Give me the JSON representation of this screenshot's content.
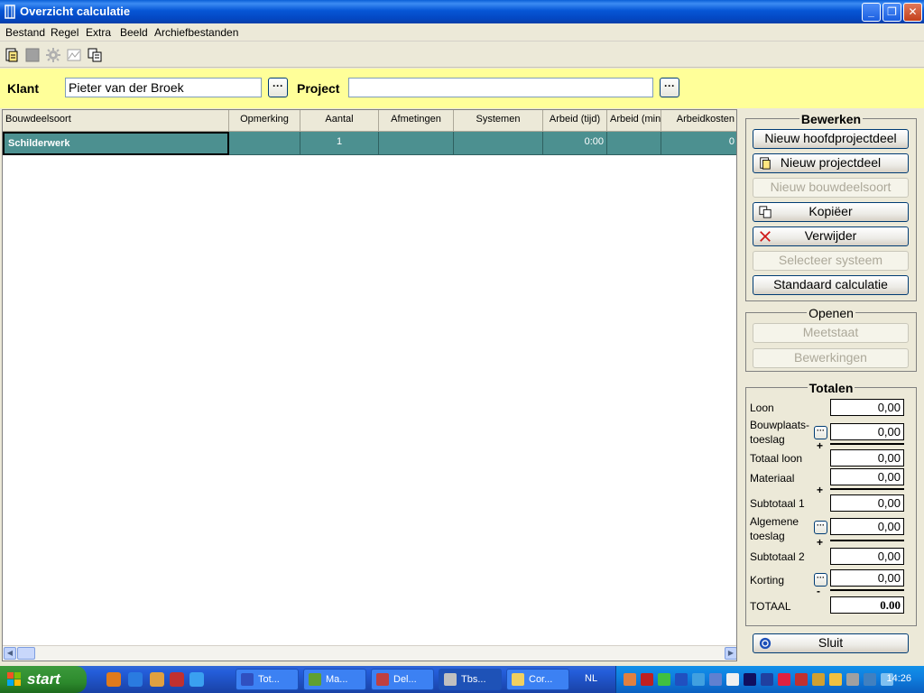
{
  "window": {
    "title": "Overzicht calculatie",
    "minimize": "_",
    "maximize": "❐",
    "close": "✕"
  },
  "menu": [
    "Bestand",
    "Regel",
    "Extra",
    "Beeld",
    "Archiefbestanden"
  ],
  "filter": {
    "klant_label": "Klant",
    "klant_value": "Pieter van der Broek",
    "project_label": "Project",
    "project_value": "",
    "ellipsis": "···"
  },
  "grid": {
    "columns": [
      "Bouwdeelsoort",
      "Opmerking",
      "Aantal",
      "Afmetingen",
      "Systemen",
      "Arbeid (tijd)",
      "Arbeid (min..",
      "Arbeidkosten"
    ],
    "rows": [
      [
        "Schilderwerk",
        "",
        "1",
        "",
        "",
        "0:00",
        "",
        "0"
      ]
    ]
  },
  "bewerken": {
    "title": "Bewerken",
    "buttons": [
      {
        "label": "Nieuw hoofdprojectdeel",
        "enabled": true
      },
      {
        "label": "Nieuw projectdeel",
        "enabled": true
      },
      {
        "label": "Nieuw bouwdeelsoort",
        "enabled": false
      },
      {
        "label": "Kopiëer",
        "enabled": true
      },
      {
        "label": "Verwijder",
        "enabled": true
      },
      {
        "label": "Selecteer systeem",
        "enabled": false
      },
      {
        "label": "Standaard calculatie",
        "enabled": true
      }
    ]
  },
  "openen": {
    "title": "Openen",
    "buttons": [
      {
        "label": "Meetstaat",
        "enabled": false
      },
      {
        "label": "Bewerkingen",
        "enabled": false
      }
    ]
  },
  "totalen": {
    "title": "Totalen",
    "plus": "+",
    "minus": "-",
    "loon_label": "Loon",
    "loon_value": "0,00",
    "bouwplaats_label_1": "Bouwplaats-",
    "bouwplaats_label_2": "toeslag",
    "bouwplaats_value": "0,00",
    "totaal_loon_label": "Totaal loon",
    "totaal_loon_value": "0,00",
    "materiaal_label": "Materiaal",
    "materiaal_value": "0,00",
    "subtotaal1_label": "Subtotaal 1",
    "subtotaal1_value": "0,00",
    "algemene_label_1": "Algemene",
    "algemene_label_2": "toeslag",
    "algemene_value": "0,00",
    "subtotaal2_label": "Subtotaal 2",
    "subtotaal2_value": "0,00",
    "korting_label": "Korting",
    "korting_value": "0,00",
    "totaal_label": "TOTAAL",
    "totaal_value": "0.00"
  },
  "sluit_label": "Sluit",
  "taskbar": {
    "start": "start",
    "tasks": [
      "Tot...",
      "Ma...",
      "Del...",
      "Tbs...",
      "Cor..."
    ],
    "language": "NL",
    "clock": "14:26"
  }
}
